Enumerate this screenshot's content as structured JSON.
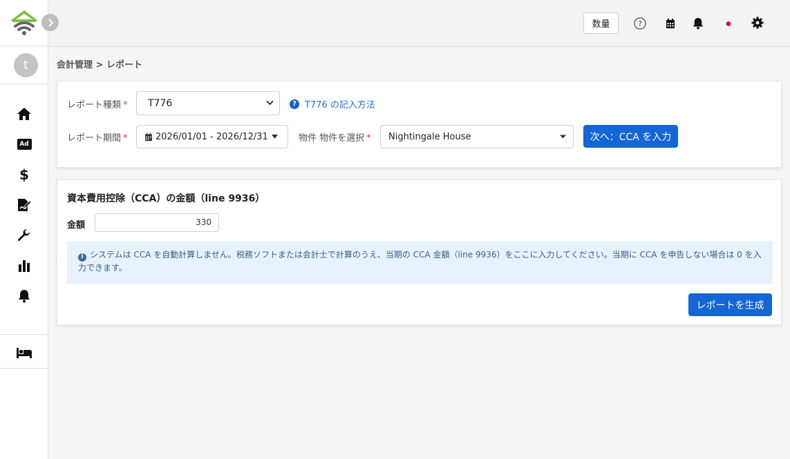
{
  "sidebar": {
    "avatar_letter": "t",
    "nav": [
      {
        "name": "home-icon"
      },
      {
        "name": "ad-icon",
        "text": "Ad"
      },
      {
        "name": "dollar-icon",
        "text": "$"
      },
      {
        "name": "signature-icon"
      },
      {
        "name": "wrench-icon"
      },
      {
        "name": "bar-chart-icon"
      },
      {
        "name": "bell-icon"
      },
      {
        "name": "bed-icon"
      }
    ]
  },
  "topbar": {
    "quantity_label": "数量",
    "icons": [
      "help-icon",
      "calendar-icon",
      "bell-icon",
      "japan-flag-icon",
      "gear-icon"
    ]
  },
  "breadcrumb": "会計管理 > レポート",
  "form": {
    "report_type_label": "レポート種類",
    "report_type_value": "T776",
    "howto_link": "T776 の記入方法",
    "period_label": "レポート期間",
    "period_value": "2026/01/01 - 2026/12/31",
    "property_label": "物件 物件を選択",
    "property_value": "Nightingale House",
    "next_button": "次へ：CCA を入力",
    "required_mark": "*"
  },
  "cca": {
    "title": "資本費用控除（CCA）の金額（line 9936）",
    "amount_label": "金額",
    "amount_value": "330",
    "info_text": "システムは CCA を自動計算しません。税務ソフトまたは会計士で計算のうえ、当期の CCA 金額（line 9936）をここに入力してください。当期に CCA を申告しない場合は 0 を入力できます。",
    "generate_button": "レポートを生成"
  },
  "colors": {
    "primary": "#1465d6",
    "logo_green": "#7cc142",
    "logo_gray": "#666666",
    "required": "#e23a3a"
  }
}
